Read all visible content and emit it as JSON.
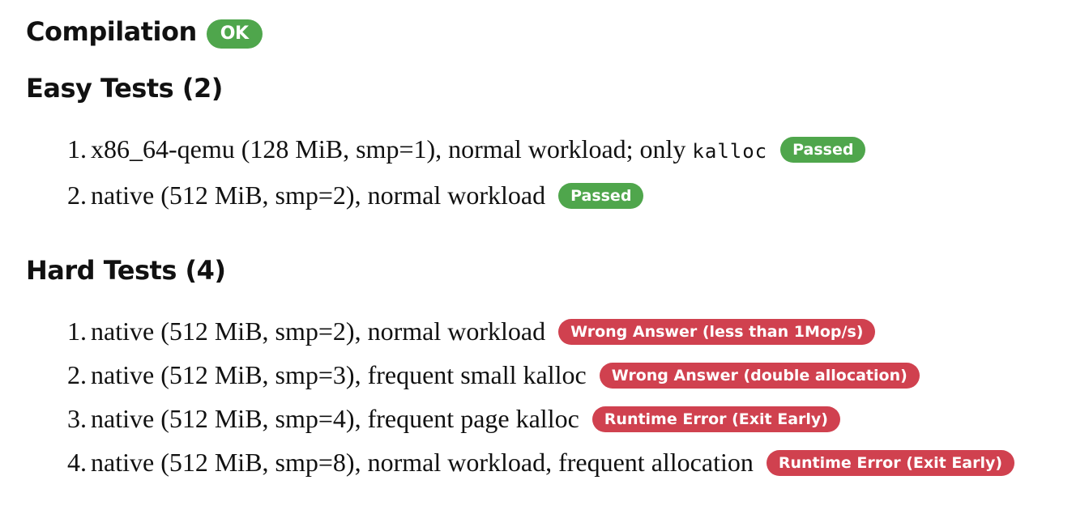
{
  "compilation": {
    "heading": "Compilation",
    "status": "OK"
  },
  "easy": {
    "heading": "Easy Tests (2)",
    "tests": [
      {
        "text": "x86_64-qemu (128 MiB, smp=1), normal workload; only ",
        "code": "kalloc",
        "status": "Passed"
      },
      {
        "text": "native (512 MiB, smp=2), normal workload",
        "status": "Passed"
      }
    ]
  },
  "hard": {
    "heading": "Hard Tests (4)",
    "tests": [
      {
        "text": "native (512 MiB, smp=2), normal workload",
        "status": "Wrong Answer (less than 1Mop/s)"
      },
      {
        "text": "native (512 MiB, smp=3), frequent small kalloc",
        "status": "Wrong Answer (double allocation)"
      },
      {
        "text": "native (512 MiB, smp=4), frequent page kalloc",
        "status": "Runtime Error (Exit Early)"
      },
      {
        "text": "native (512 MiB, smp=8), normal workload, frequent allocation",
        "status": "Runtime Error (Exit Early)"
      }
    ]
  },
  "colors": {
    "pass": "#4fa64c",
    "fail": "#d0414f"
  }
}
